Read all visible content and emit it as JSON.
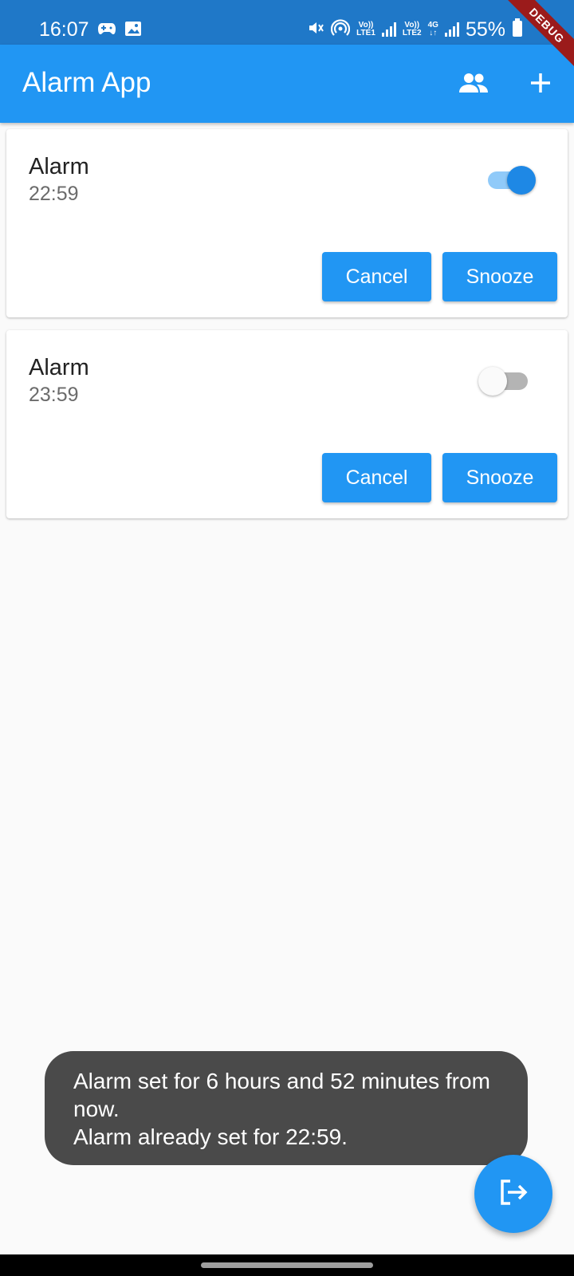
{
  "status_bar": {
    "time": "16:07",
    "battery_percent": "55%",
    "sim1_top": "Vo))",
    "sim1_bottom": "LTE1",
    "sim2_top": "Vo))",
    "sim2_bottom": "LTE2",
    "network": "4G",
    "icons": [
      "game-controller-icon",
      "image-icon",
      "mute-icon",
      "hotspot-icon",
      "signal-icon",
      "battery-icon"
    ]
  },
  "debug_banner": "DEBUG",
  "app_bar": {
    "title": "Alarm App",
    "actions": [
      "people-icon",
      "add-icon"
    ]
  },
  "alarms": [
    {
      "title": "Alarm",
      "time": "22:59",
      "enabled": true,
      "cancel_label": "Cancel",
      "snooze_label": "Snooze"
    },
    {
      "title": "Alarm",
      "time": "23:59",
      "enabled": false,
      "cancel_label": "Cancel",
      "snooze_label": "Snooze"
    }
  ],
  "toast": {
    "line1": "Alarm set for 6 hours and 52 minutes from now.",
    "line2": "Alarm already set for 22:59."
  },
  "fab": {
    "icon": "logout-icon"
  },
  "colors": {
    "primary": "#2196f3",
    "status_bar": "#1f78c8",
    "toast_bg": "#4a4a4a",
    "debug": "#9b1b1b"
  }
}
